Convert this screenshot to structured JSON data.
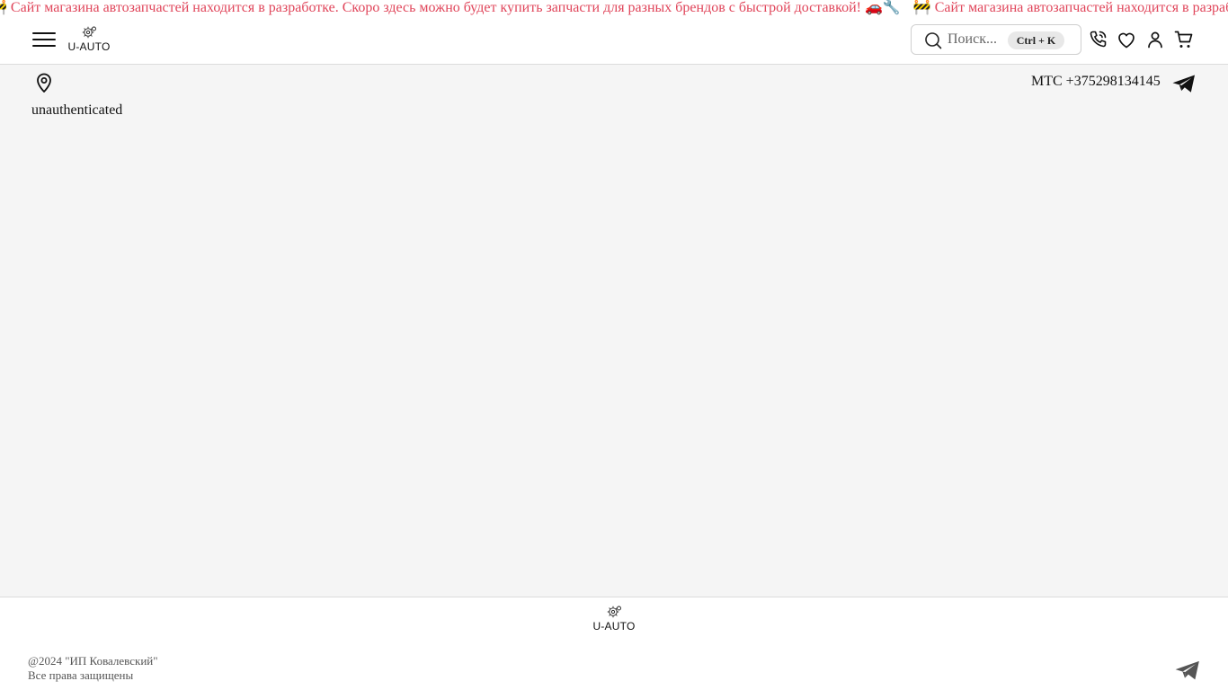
{
  "ticker": {
    "message": "🚧 Сайт магазина автозапчастей находится в разработке. Скоро здесь можно будет купить запчасти для разных брендов с быстрой доставкой! 🚗🔧",
    "color": "#e0455a"
  },
  "header": {
    "logo_text": "U-AUTO",
    "menu_icon": "hamburger-icon",
    "search": {
      "placeholder": "Поиск...",
      "shortcut": "Ctrl + K",
      "icon": "search-icon"
    },
    "icons": [
      "phone-icon",
      "heart-icon",
      "user-icon",
      "cart-icon"
    ]
  },
  "subbar": {
    "location_icon": "map-pin-icon",
    "auth_status": "unauthenticated",
    "phone": "МТС +375298134145",
    "telegram_icon": "telegram-icon"
  },
  "footer": {
    "logo_text": "U-AUTO",
    "copyright_line1": "@2024 \"ИП Ковалевский\"",
    "copyright_line2": "Все права защищены",
    "telegram_icon": "telegram-icon"
  }
}
